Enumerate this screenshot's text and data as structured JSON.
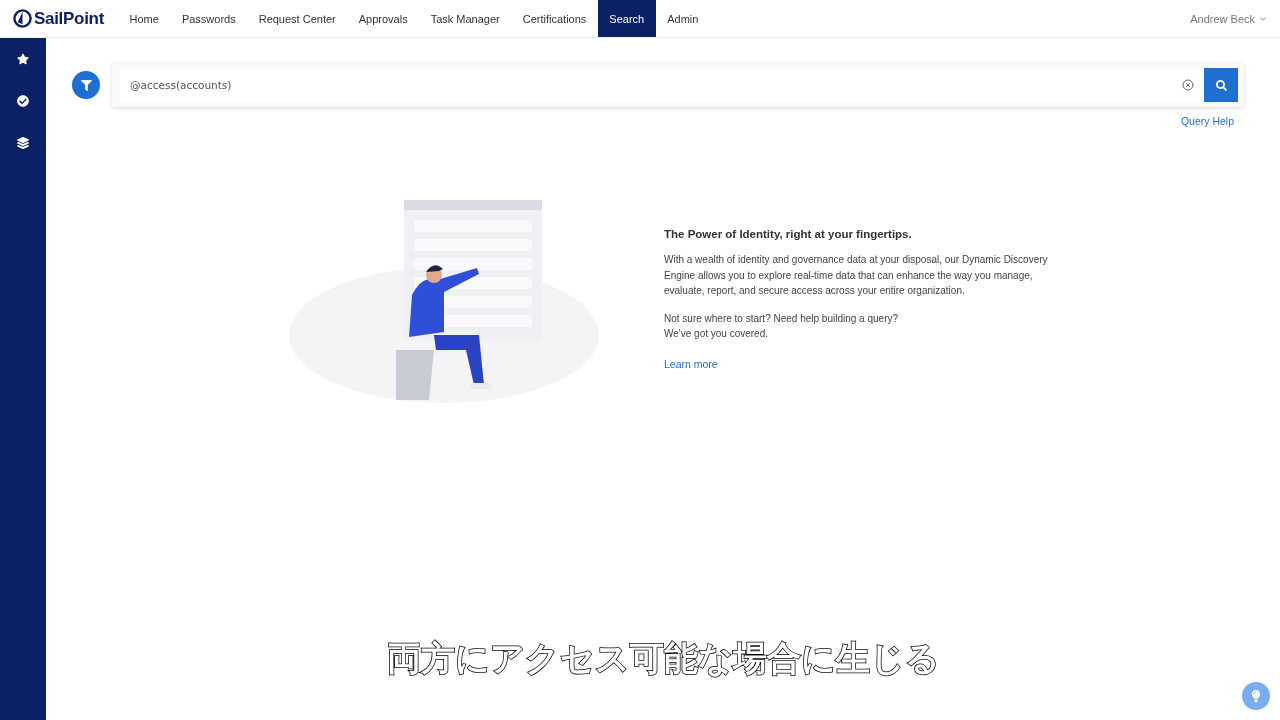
{
  "brand": {
    "name": "SailPoint"
  },
  "nav": [
    {
      "label": "Home",
      "selected": false
    },
    {
      "label": "Passwords",
      "selected": false
    },
    {
      "label": "Request Center",
      "selected": false
    },
    {
      "label": "Approvals",
      "selected": false
    },
    {
      "label": "Task Manager",
      "selected": false
    },
    {
      "label": "Certifications",
      "selected": false
    },
    {
      "label": "Search",
      "selected": true
    },
    {
      "label": "Admin",
      "selected": false
    }
  ],
  "user": {
    "name": "Andrew Beck"
  },
  "sidebar": {
    "items": [
      {
        "kind": "star"
      },
      {
        "kind": "check"
      },
      {
        "kind": "layers"
      }
    ]
  },
  "search": {
    "value": "@access(accounts)"
  },
  "query_help": "Query Help",
  "intro": {
    "title": "The Power of Identity, right at your fingertips.",
    "paragraph": "With a wealth of identity and governance data at your disposal, our Dynamic Discovery Engine allows you to explore real-time data that can enhance the way you manage, evaluate, report, and secure access across your entire organization.",
    "help_lines": [
      "Not sure where to start? Need help building a query?",
      "We've got you covered."
    ],
    "link": "Learn more"
  },
  "subtitle": "両方にアクセス可能な場合に生じる"
}
